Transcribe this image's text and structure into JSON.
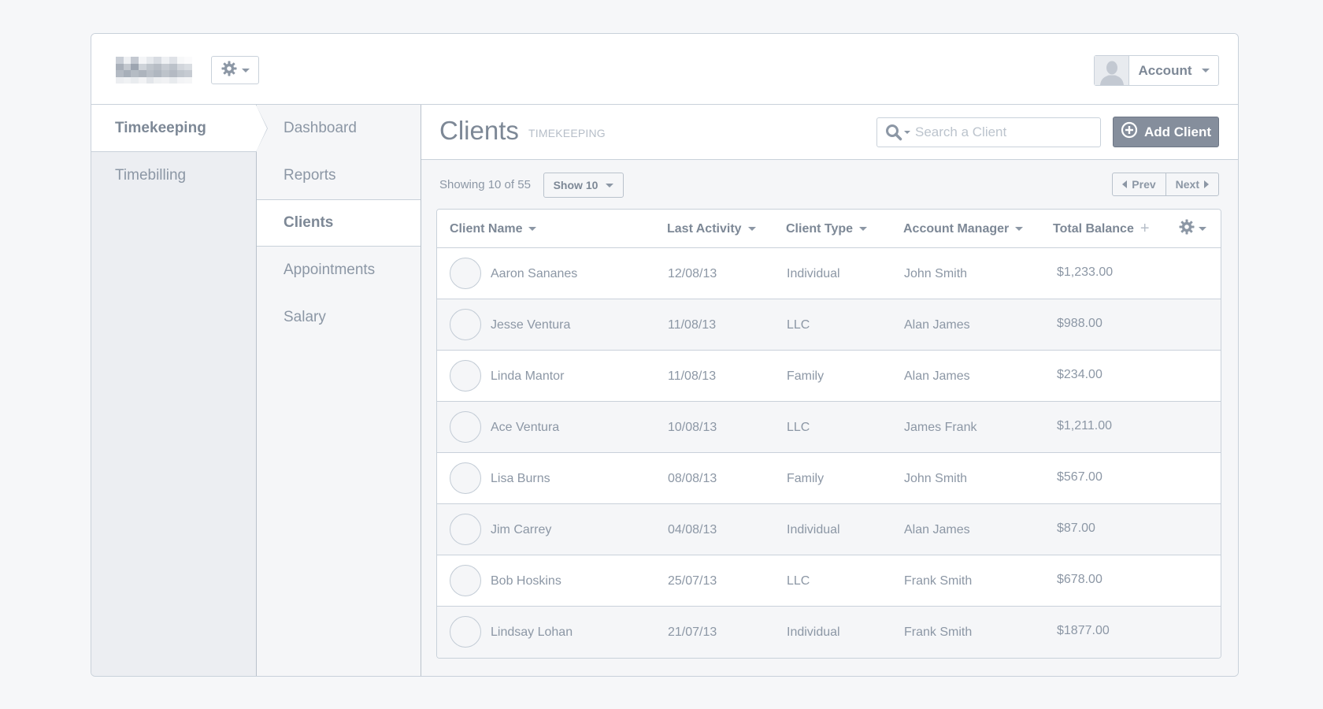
{
  "topbar": {
    "account_label": "Account",
    "icons": {
      "settings": "gear-icon",
      "account_avatar": "user-silhouette-icon"
    }
  },
  "nav_primary": {
    "items": [
      {
        "label": "Timekeeping",
        "active": true
      },
      {
        "label": "Timebilling",
        "active": false
      }
    ]
  },
  "nav_secondary": {
    "items": [
      {
        "label": "Dashboard",
        "active": false
      },
      {
        "label": "Reports",
        "active": false
      },
      {
        "label": "Clients",
        "active": true
      },
      {
        "label": "Appointments",
        "active": false
      },
      {
        "label": "Salary",
        "active": false
      }
    ]
  },
  "header": {
    "title": "Clients",
    "subtitle": "TIMEKEEPING",
    "search_placeholder": "Search a Client",
    "search_value": "",
    "add_button_label": "Add Client"
  },
  "toolbar": {
    "showing_text": "Showing 10 of 55",
    "show_select_value": "Show 10",
    "prev_label": "Prev",
    "next_label": "Next"
  },
  "table": {
    "columns": [
      {
        "label": "Client Name",
        "indicator": "caret"
      },
      {
        "label": "Last Activity",
        "indicator": "caret"
      },
      {
        "label": "Client Type",
        "indicator": "caret"
      },
      {
        "label": "Account Manager",
        "indicator": "caret"
      },
      {
        "label": "Total Balance",
        "indicator": "plus"
      }
    ],
    "rows": [
      {
        "name": "Aaron Sananes",
        "last_activity": "12/08/13",
        "type": "Individual",
        "manager": "John Smith",
        "balance": "$1,233.00"
      },
      {
        "name": "Jesse Ventura",
        "last_activity": "11/08/13",
        "type": "LLC",
        "manager": "Alan James",
        "balance": "$988.00"
      },
      {
        "name": "Linda Mantor",
        "last_activity": "11/08/13",
        "type": "Family",
        "manager": "Alan James",
        "balance": "$234.00"
      },
      {
        "name": "Ace Ventura",
        "last_activity": "10/08/13",
        "type": "LLC",
        "manager": "James Frank",
        "balance": "$1,211.00"
      },
      {
        "name": "Lisa Burns",
        "last_activity": "08/08/13",
        "type": "Family",
        "manager": "John Smith",
        "balance": "$567.00"
      },
      {
        "name": "Jim Carrey",
        "last_activity": "04/08/13",
        "type": "Individual",
        "manager": "Alan James",
        "balance": "$87.00"
      },
      {
        "name": "Bob Hoskins",
        "last_activity": "25/07/13",
        "type": "LLC",
        "manager": "Frank Smith",
        "balance": "$678.00"
      },
      {
        "name": "Lindsay Lohan",
        "last_activity": "21/07/13",
        "type": "Individual",
        "manager": "Frank Smith",
        "balance": "$1877.00"
      }
    ]
  },
  "colors": {
    "page_bg": "#f6f7f9",
    "border": "#c9d1da",
    "text": "#7d8896",
    "muted_text": "#b6bec8",
    "primary_button": "#858e9c",
    "sidebar_bg": "#eceef2",
    "subnav_bg": "#f5f6f8"
  }
}
